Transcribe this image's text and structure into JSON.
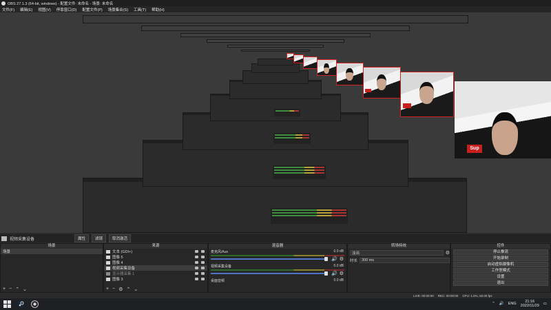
{
  "window": {
    "title": "OBS 27.1.3 (64-bit, windows) - 配置文件: 未命名 - 场景: 未命名"
  },
  "menu": [
    "文件(F)",
    "编辑(E)",
    "视图(V)",
    "停靠窗口(D)",
    "配置文件(P)",
    "场景集合(S)",
    "工具(T)",
    "帮助(H)"
  ],
  "dock_header": {
    "source_label": "视频采集设备",
    "properties": "属性",
    "filters": "滤镜",
    "deactivate": "取消激活"
  },
  "scenes": {
    "title": "场景",
    "items": [
      "场景"
    ]
  },
  "sources": {
    "title": "来源",
    "items": [
      "文本 (GDI+)",
      "图像 5",
      "图像 4",
      "视频采集设备",
      "显示器采集 1",
      "图像 3"
    ]
  },
  "mixer": {
    "title": "混音器",
    "channels": [
      {
        "name": "麦克风/Aux",
        "db": "0.0 dB"
      },
      {
        "name": "视频采集设备",
        "db": "0.0 dB"
      },
      {
        "name": "桌面音频",
        "db": "0.0 dB"
      }
    ]
  },
  "transitions": {
    "title": "转场特效",
    "type": "淡出",
    "duration_label": "时长",
    "duration": "300 ms"
  },
  "controls": {
    "title": "控件",
    "buttons": [
      "停止推流",
      "开始录制",
      "启动虚拟摄像机",
      "工作室模式",
      "设置",
      "退出"
    ]
  },
  "status": {
    "live": "LIVE: 00:00:00",
    "rec": "REC: 00:00:00",
    "cpu": "CPU: 1.5%, 60.00 fps"
  },
  "taskbar": {
    "lang": "ENG",
    "time": "21:16",
    "date": "2022/11/29"
  },
  "colors": {
    "accent_fader": "#4e73c7",
    "cam_border": "#cc2222",
    "brand_red": "#c8201f"
  }
}
